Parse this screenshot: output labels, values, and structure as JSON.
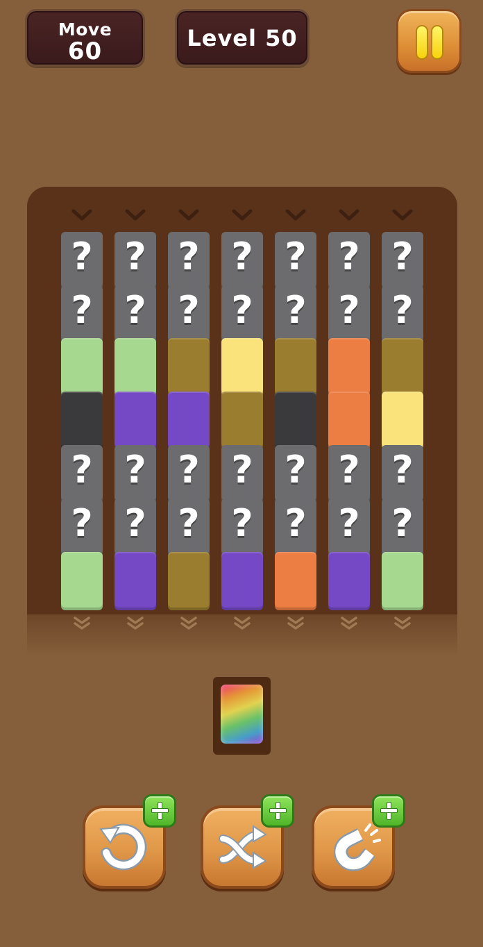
{
  "hud": {
    "moves_label": "Move",
    "moves_value": "60",
    "level_label": "Level 50"
  },
  "board": {
    "columns": 7,
    "question_mark": "?",
    "grid": [
      [
        "hidden",
        "hidden",
        "hidden",
        "hidden",
        "hidden",
        "hidden",
        "hidden"
      ],
      [
        "hidden",
        "hidden",
        "hidden",
        "hidden",
        "hidden",
        "hidden",
        "hidden"
      ],
      [
        "light-green",
        "light-green",
        "olive",
        "yellow",
        "olive",
        "orange",
        "olive"
      ],
      [
        "charcoal",
        "purple",
        "purple",
        "olive",
        "charcoal",
        "orange",
        "yellow"
      ],
      [
        "hidden",
        "hidden",
        "hidden",
        "hidden",
        "hidden",
        "hidden",
        "hidden"
      ],
      [
        "hidden",
        "hidden",
        "hidden",
        "hidden",
        "hidden",
        "hidden",
        "hidden"
      ],
      [
        "light-green",
        "purple",
        "olive",
        "purple",
        "orange",
        "purple",
        "light-green"
      ]
    ],
    "colors": {
      "light-green": "#a6d88f",
      "olive": "#9a7d2f",
      "yellow": "#f9e37a",
      "orange": "#ec7e44",
      "purple": "#7549c6",
      "charcoal": "#3a393b",
      "hidden": "#6c6c6e"
    }
  },
  "slot": {
    "tile": "rainbow"
  },
  "boosters": [
    {
      "name": "undo",
      "icon": "undo-icon"
    },
    {
      "name": "shuffle",
      "icon": "shuffle-icon"
    },
    {
      "name": "magnet",
      "icon": "magnet-icon"
    }
  ]
}
